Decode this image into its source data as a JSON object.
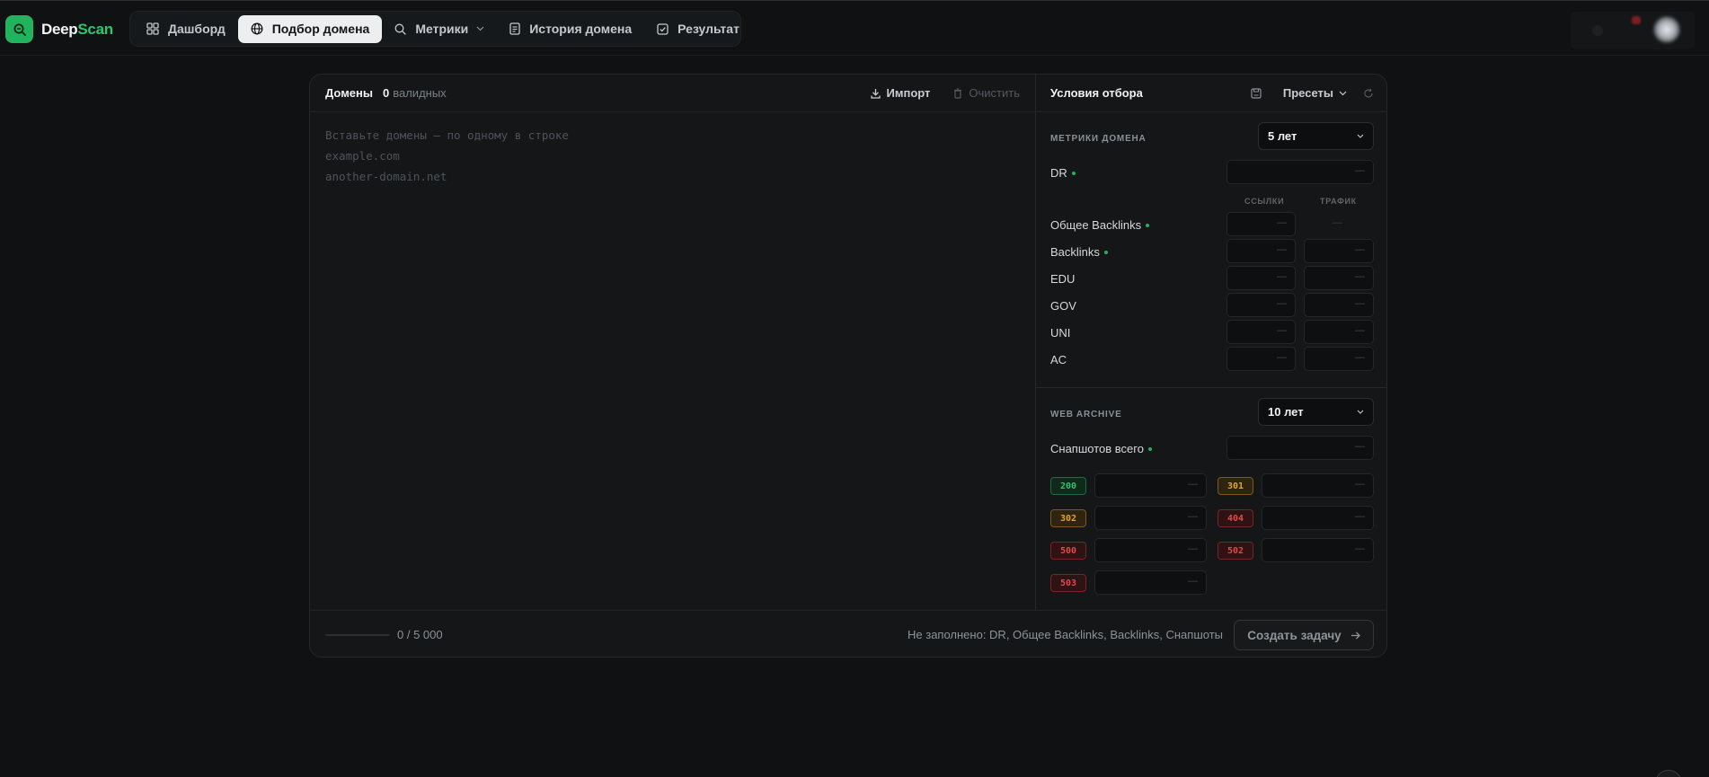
{
  "brand": {
    "name_part1": "Deep",
    "name_part2": "Scan",
    "accent": "#22b35f"
  },
  "nav": {
    "items": [
      {
        "label": "Дашборд",
        "icon": "grid-icon"
      },
      {
        "label": "Подбор домена",
        "icon": "globe-icon",
        "active": true
      },
      {
        "label": "Метрики",
        "icon": "search-icon",
        "dropdown": true
      },
      {
        "label": "История домена",
        "icon": "document-icon"
      },
      {
        "label": "Результат",
        "icon": "check-square-icon"
      }
    ]
  },
  "domains": {
    "title": "Домены",
    "valid_count": "0",
    "valid_label": "валидных",
    "import_label": "Импорт",
    "clear_label": "Очистить",
    "placeholder_lines": [
      "Вставьте домены — по одному в строке",
      "example.com",
      "another-domain.net"
    ]
  },
  "filters": {
    "title": "Условия отбора",
    "presets_label": "Пресеты",
    "domain_metrics": {
      "section_label": "МЕТРИКИ ДОМЕНА",
      "period": "5 лет",
      "dr_label": "DR",
      "col_links": "ССЫЛКИ",
      "col_traffic": "ТРАФИК",
      "rows": [
        {
          "label": "Общее Backlinks",
          "required": true
        },
        {
          "label": "Backlinks",
          "required": true
        },
        {
          "label": "EDU",
          "required": false
        },
        {
          "label": "GOV",
          "required": false
        },
        {
          "label": "UNI",
          "required": false
        },
        {
          "label": "AC",
          "required": false
        }
      ]
    },
    "web_archive": {
      "section_label": "WEB ARCHIVE",
      "period": "10 лет",
      "snapshots_label": "Снапшотов всего",
      "codes": [
        {
          "code": "200",
          "color": "#2fc470",
          "bg": "#0f2a1b",
          "border": "#1f6b3f"
        },
        {
          "code": "301",
          "color": "#e0a62a",
          "bg": "#2e2410",
          "border": "#7a5a1a"
        },
        {
          "code": "302",
          "color": "#e0a62a",
          "bg": "#2e2410",
          "border": "#7a5a1a"
        },
        {
          "code": "404",
          "color": "#e04a4a",
          "bg": "#2e1214",
          "border": "#7a2326"
        },
        {
          "code": "500",
          "color": "#e04a4a",
          "bg": "#2e1214",
          "border": "#7a2326"
        },
        {
          "code": "502",
          "color": "#e04a4a",
          "bg": "#2e1214",
          "border": "#7a2326"
        },
        {
          "code": "503",
          "color": "#e04a4a",
          "bg": "#2e1214",
          "border": "#7a2326"
        }
      ]
    }
  },
  "footer": {
    "progress": 0,
    "counter": "0 / 5 000",
    "missing": "Не заполнено: DR, Общее Backlinks, Backlinks, Снапшоты",
    "create_label": "Создать задачу"
  }
}
